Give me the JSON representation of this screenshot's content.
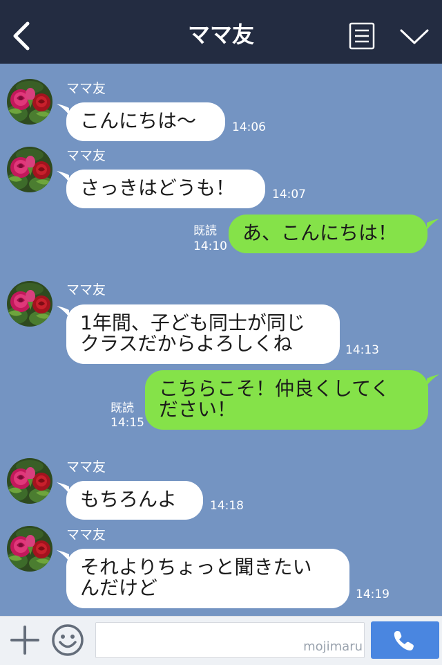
{
  "header": {
    "title": "ママ友",
    "back_icon": "chevron-left-icon",
    "menu_icon": "list-menu-icon",
    "collapse_icon": "chevron-down-icon",
    "background": "#232c41"
  },
  "chat": {
    "background": "#7494c2",
    "incoming_bubble_color": "#ffffff",
    "outgoing_bubble_color": "#85e249",
    "messages": [
      {
        "direction": "in",
        "sender": "ママ友",
        "text": "こんにちは〜",
        "time": "14:06"
      },
      {
        "direction": "in",
        "sender": "ママ友",
        "text": "さっきはどうも！",
        "time": "14:07"
      },
      {
        "direction": "out",
        "read": "既読",
        "text": "あ、こんにちは！",
        "time": "14:10"
      },
      {
        "direction": "in",
        "sender": "ママ友",
        "text": "1年間、子ども同士が同じ\nクラスだからよろしくね",
        "time": "14:13"
      },
      {
        "direction": "out",
        "read": "既読",
        "text": "こちらこそ！仲良くしてく\nださい！",
        "time": "14:15"
      },
      {
        "direction": "in",
        "sender": "ママ友",
        "text": "もちろんよ",
        "time": "14:18"
      },
      {
        "direction": "in",
        "sender": "ママ友",
        "text": "それよりちょっと聞きたい\nんだけど",
        "time": "14:19"
      }
    ]
  },
  "input_bar": {
    "plus_icon": "plus-icon",
    "emoji_icon": "smiley-icon",
    "input_value": "",
    "watermark": "mojimaru",
    "call_icon": "phone-icon",
    "call_button_color": "#4a86e0"
  }
}
